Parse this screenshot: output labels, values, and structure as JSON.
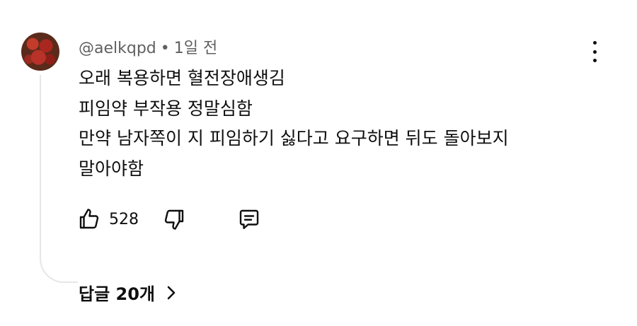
{
  "comment": {
    "username": "@aelkqpd",
    "separator": "•",
    "timestamp": "1일 전",
    "lines": [
      "오래 복용하면 혈전장애생김",
      "피임약 부작용 정말심함",
      "만약 남자쪽이 지 피임하기 싫다고 요구하면 뒤도 돌아보지",
      "말아야함"
    ],
    "like_count": "528",
    "replies_label": "답글 20개"
  },
  "icons": {
    "more": "more-vert-icon",
    "like": "thumbs-up-icon",
    "dislike": "thumbs-down-icon",
    "reply": "comment-icon",
    "chevron": "chevron-right-icon"
  }
}
